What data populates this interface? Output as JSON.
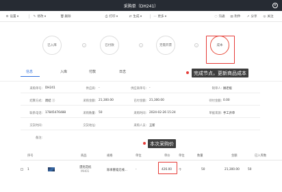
{
  "window": {
    "title": "采购单（DH241）",
    "close_glyph": "✕"
  },
  "toolbar": {
    "left": [
      {
        "icon": "gear-icon",
        "glyph": "⚙",
        "label": "设置 ▾"
      },
      {
        "icon": "edit-icon",
        "glyph": "✎",
        "label": "修改 ▾"
      },
      {
        "icon": "trash-icon",
        "glyph": "🗑",
        "label": "删除"
      },
      {
        "icon": "print-icon",
        "glyph": "⎙",
        "label": "打印 ▾"
      },
      {
        "icon": "generate-icon",
        "glyph": "⇄",
        "label": "生成 ▾"
      },
      {
        "icon": "more-icon",
        "glyph": "···",
        "label": "更多 ▾"
      }
    ],
    "right": [
      {
        "icon": "chat-icon",
        "glyph": "◌",
        "label": "沟通"
      },
      {
        "icon": "file-icon",
        "glyph": "▤",
        "label": "附件"
      },
      {
        "icon": "share-icon",
        "glyph": "↗",
        "label": "分享"
      },
      {
        "icon": "follow-icon",
        "glyph": "◎",
        "label": "关注"
      }
    ]
  },
  "flow": {
    "nodes": [
      "已入库",
      "已付款",
      "无需开票",
      "成本"
    ],
    "arrow_glyph": "›",
    "done_index": 3
  },
  "tabs": [
    {
      "label": "信息",
      "active": true
    },
    {
      "label": "入库",
      "active": false
    },
    {
      "label": "付款",
      "active": false
    },
    {
      "label": "日志",
      "active": false
    }
  ],
  "callouts": {
    "complete": "完成节点，更新商品成本",
    "price": "本次采购价"
  },
  "form": {
    "rows": [
      [
        {
          "label": "采购单号:",
          "value": "DH241"
        },
        {
          "label": "供应商:",
          "value": "-"
        },
        {
          "label": "供应商单号:",
          "value": "-"
        },
        {
          "label": "制单人:",
          "value": "顾老板"
        }
      ],
      [
        {
          "label": "结算方式:",
          "value": "周结  ⓘ"
        },
        {
          "label": "采购金额:",
          "value": "21,300.00"
        },
        {
          "label": "已付金额:",
          "value": "21,300.00"
        },
        {
          "label": "待付金额:",
          "value": "0.00"
        }
      ],
      [
        {
          "label": "联系电话:",
          "value": "17845476488"
        },
        {
          "label": "采购数量:",
          "value": "50"
        },
        {
          "label": "采购时间:",
          "value": "2024-02-26 15:24"
        },
        {
          "label": "单据来源:",
          "value": "手工开单"
        }
      ],
      [
        {
          "label": "交货时间:",
          "value": ""
        },
        {
          "label": "交货地址:",
          "value": ""
        },
        {
          "label": "采购人员:",
          "value": "王新"
        },
        {
          "label": "",
          "value": ""
        }
      ]
    ],
    "remark_label": "备注:"
  },
  "table": {
    "headers": {
      "seq": "序号",
      "product": "商品",
      "spec": "规格",
      "unit_label": "单位",
      "price": "单价",
      "unit": "单位",
      "qty": "数量",
      "amount": "金额",
      "received": "已入库数"
    },
    "rows": [
      {
        "seq": "1",
        "name": "漂亮花机",
        "code": "MH01",
        "spec": "除承重墙无线...",
        "spec_unit": "-",
        "price": "426.00",
        "unit": "个",
        "qty": "50",
        "amount": "21,300.00",
        "received": "50"
      }
    ]
  },
  "colors": {
    "titlebar": "#262b33",
    "accent": "#2f6fde",
    "highlight": "#e53935",
    "callout_bg": "#3d3d3d"
  }
}
